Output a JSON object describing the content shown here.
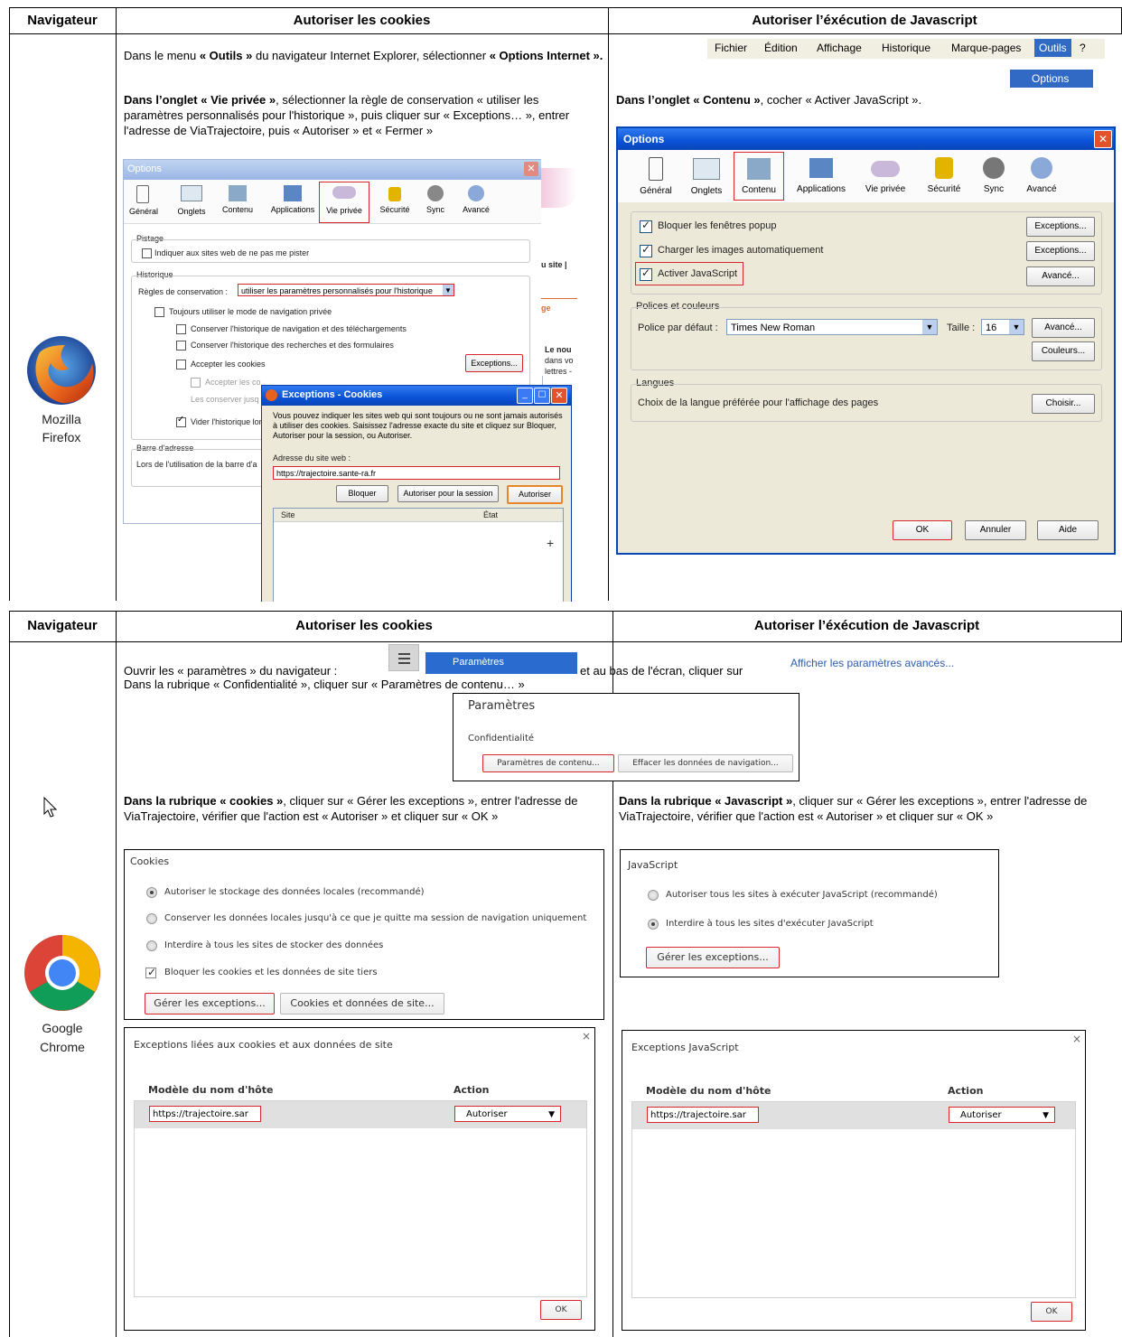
{
  "table1": {
    "headers": {
      "browser": "Navigateur",
      "cookies": "Autoriser les cookies",
      "javascript": "Autoriser l’éxécution de Javascript"
    },
    "browser_name": [
      "Mozilla",
      "Firefox"
    ],
    "intro": {
      "part1": "Dans le menu ",
      "menu_bold": "« Outils »",
      "part2": " du navigateur Internet Explorer, sélectionner ",
      "options_bold": "« Options Internet »."
    },
    "menubar": {
      "items": [
        "Fichier",
        "Édition",
        "Affichage",
        "Historique",
        "Marque-pages",
        "Outils",
        "?"
      ],
      "dropdown_item": "Options"
    },
    "cookies_instr": {
      "bold": "Dans l’onglet « Vie privée »",
      "rest": ", sélectionner la règle de conservation « utiliser les paramètres personnalisés pour l'historique », puis cliquer sur « Exceptions… », entrer l'adresse de ViaTrajectoire, puis « Autoriser » et « Fermer »"
    },
    "js_instr": {
      "bold": "Dans l’onglet « Contenu »",
      "rest": ", cocher « Activer JavaScript »."
    },
    "left_dialog": {
      "title": "Options",
      "tabs": [
        "Général",
        "Onglets",
        "Contenu",
        "Applications",
        "Vie privée",
        "Sécurité",
        "Sync",
        "Avancé"
      ],
      "pistage_label": "Pistage",
      "pistage_option": "Indiquer aux sites web de ne pas me pister",
      "historique_label": "Historique",
      "rules_label": "Règles de conservation :",
      "rules_value": "utiliser les paramètres personnalisés pour l'historique",
      "private_mode": "Toujours utiliser le mode de navigation privée",
      "keep_nav": "Conserver l'historique de navigation et des téléchargements",
      "keep_search": "Conserver l'historique des recherches et des formulaires",
      "accept_cookies": "Accepter les cookies",
      "accept_third": "Accepter les co",
      "keep_until": "Les conserver jusq",
      "clear_history": "Vider l'historique lor",
      "exceptions_btn": "Exceptions...",
      "address_bar_label": "Barre d'adresse",
      "address_bar_text": "Lors de l'utilisation de la barre d'a",
      "bg_fragments": [
        "u site  |",
        "ge",
        "Le nou",
        "dans vo",
        "lettres -"
      ]
    },
    "exceptions_dialog": {
      "title": "Exceptions - Cookies",
      "description": "Vous pouvez indiquer les sites web qui sont toujours ou ne sont jamais autorisés à utiliser des cookies. Saisissez l'adresse exacte du site et cliquez sur Bloquer, Autoriser pour la session, ou Autoriser.",
      "address_label": "Adresse du site web :",
      "address_value": "https://trajectoire.sante-ra.fr",
      "btn_block": "Bloquer",
      "btn_session": "Autoriser pour la session",
      "btn_allow": "Autoriser",
      "col_site": "Site",
      "col_state": "État"
    },
    "right_dialog": {
      "title": "Options",
      "tabs": [
        "Général",
        "Onglets",
        "Contenu",
        "Applications",
        "Vie privée",
        "Sécurité",
        "Sync",
        "Avancé"
      ],
      "block_popup": "Bloquer les fenêtres popup",
      "load_images": "Charger les images automatiquement",
      "enable_js": "Activer JavaScript",
      "btn_exceptions1": "Exceptions...",
      "btn_exceptions2": "Exceptions...",
      "btn_advanced1": "Avancé...",
      "fonts_label": "Polices et couleurs",
      "default_font_label": "Police par défaut :",
      "default_font_value": "Times New Roman",
      "size_label": "Taille :",
      "size_value": "16",
      "btn_advanced2": "Avancé...",
      "btn_colors": "Couleurs...",
      "languages_label": "Langues",
      "languages_text": "Choix de la langue préférée pour l'affichage des pages",
      "btn_choose": "Choisir...",
      "btn_ok": "OK",
      "btn_cancel": "Annuler",
      "btn_help": "Aide"
    }
  },
  "table2": {
    "headers": {
      "browser": "Navigateur",
      "cookies": "Autoriser les cookies",
      "javascript": "Autoriser l’éxécution de Javascript"
    },
    "browser_name": [
      "Google",
      "Chrome"
    ],
    "intro1_a": "Ouvrir les « paramètres » du navigateur :",
    "intro1_b": "et au bas de l'écran, cliquer sur",
    "menu_item": "Paramètres",
    "advanced_link": "Afficher les paramètres avancés...",
    "intro2": "Dans la rubrique « Confidentialité », cliquer sur « Paramètres de contenu… »",
    "settings_panel": {
      "title": "Paramètres",
      "privacy": "Confidentialité",
      "btn_content": "Paramètres de contenu...",
      "btn_clear": "Effacer les données de navigation..."
    },
    "cookies_instr": {
      "bold": "Dans la rubrique « cookies »",
      "rest": ", cliquer sur « Gérer les exceptions », entrer l'adresse de ViaTrajectoire, vérifier que l'action est « Autoriser » et cliquer sur « OK »"
    },
    "js_instr": {
      "bold": "Dans la rubrique « Javascript »",
      "rest": ", cliquer sur « Gérer les exceptions », entrer l'adresse de ViaTrajectoire, vérifier que l'action est « Autoriser » et cliquer sur « OK »"
    },
    "cookies_panel": {
      "title": "Cookies",
      "opt1": "Autoriser le stockage des données locales (recommandé)",
      "opt2": "Conserver les données locales jusqu'à ce que je quitte ma session de navigation uniquement",
      "opt3": "Interdire à tous les sites de stocker des données",
      "opt4": "Bloquer les cookies et les données de site tiers",
      "btn_manage": "Gérer les exceptions...",
      "btn_cookies_data": "Cookies et données de site..."
    },
    "js_panel": {
      "title": "JavaScript",
      "opt1": "Autoriser tous les sites à exécuter JavaScript (recommandé)",
      "opt2": "Interdire à tous les sites d'exécuter JavaScript",
      "btn_manage": "Gérer les exceptions..."
    },
    "cookie_exceptions": {
      "title": "Exceptions liées aux cookies et aux données de site",
      "col_host": "Modèle du nom d'hôte",
      "col_action": "Action",
      "host_value": "https://trajectoire.sar",
      "action_value": "Autoriser",
      "btn_ok": "OK",
      "close": "×"
    },
    "js_exceptions": {
      "title": "Exceptions JavaScript",
      "col_host": "Modèle du nom d'hôte",
      "col_action": "Action",
      "host_value": "https://trajectoire.sar",
      "action_value": "Autoriser",
      "btn_ok": "OK",
      "close": "×"
    }
  },
  "colors": {
    "accent_red": "#d6262e",
    "xp_blue": "#0a5fd8",
    "menu_blue": "#316ac5"
  },
  "icons": [
    "firefox-logo",
    "chrome-logo",
    "mouse-cursor-icon",
    "hamburger-menu-icon"
  ]
}
